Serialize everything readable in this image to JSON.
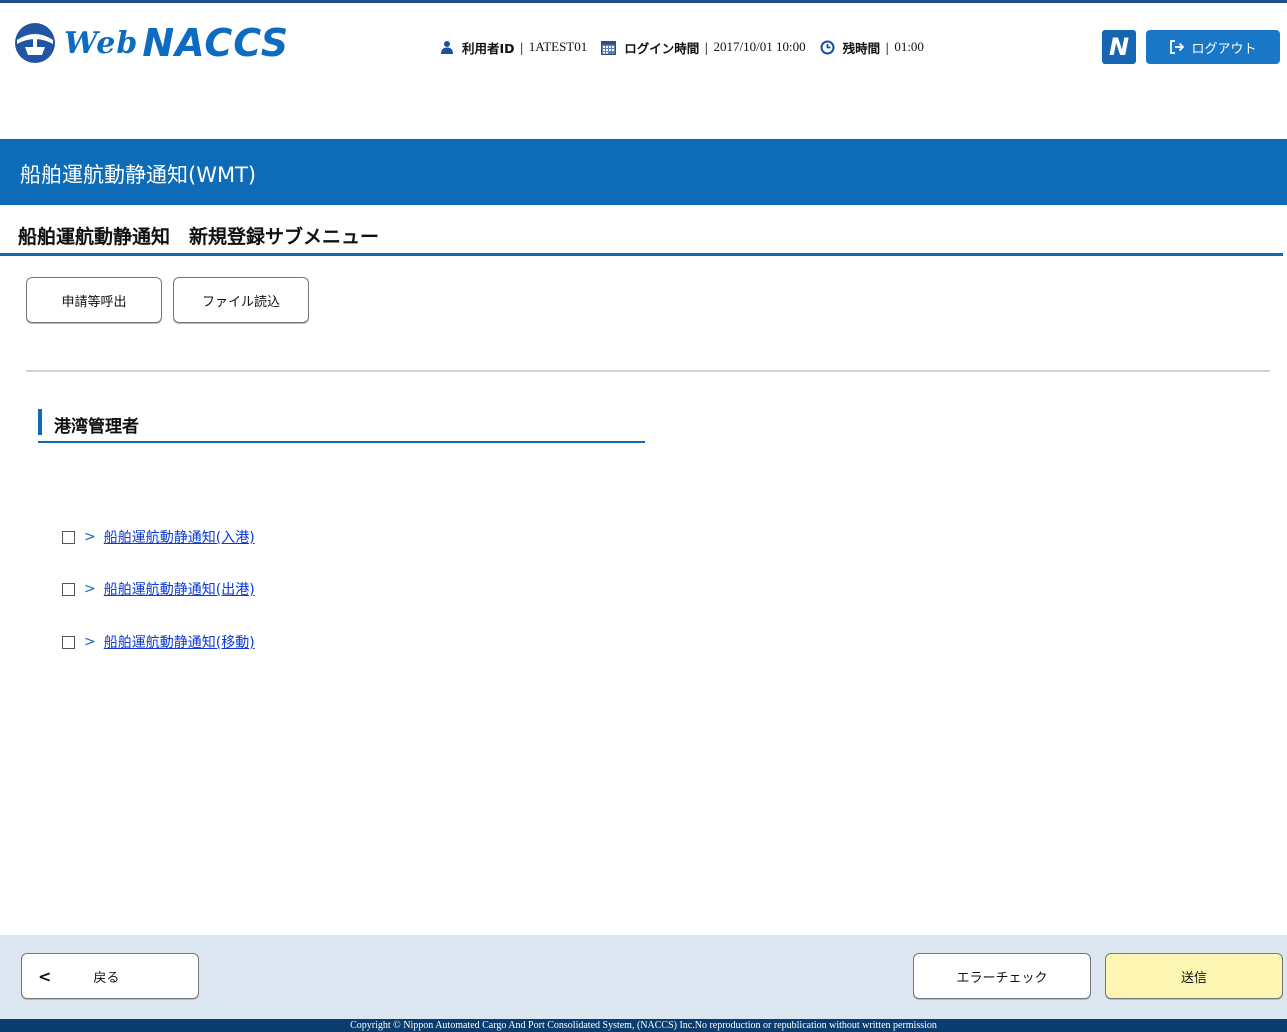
{
  "header": {
    "logo_web": "Web",
    "logo_naccs": "NACCS",
    "user_id_label": "利用者ID",
    "user_id": "1ATEST01",
    "login_time_label": "ログイン時間",
    "login_time": "2017/10/01 10:00",
    "remaining_label": "残時間",
    "remaining": "01:00",
    "n_icon": "N",
    "logout_label": "ログアウト",
    "separator": "|"
  },
  "page": {
    "title": "船舶運航動静通知(WMT)",
    "subtitle": "船舶運航動静通知　新規登録サブメニュー"
  },
  "toolbar": {
    "apply_label": "申請等呼出",
    "file_label": "ファイル読込"
  },
  "section": {
    "title": "港湾管理者",
    "items": [
      {
        "label": "船舶運航動静通知(入港)"
      },
      {
        "label": "船舶運航動静通知(出港)"
      },
      {
        "label": "船舶運航動静通知(移動)"
      }
    ]
  },
  "footer": {
    "back_label": "戻る",
    "error_check_label": "エラーチェック",
    "send_label": "送信",
    "copyright": "Copyright © Nippon Automated Cargo And Port Consolidated System, (NACCS) Inc.No reproduction or republication without written permission"
  },
  "colors": {
    "brand_blue": "#0d6bb8",
    "footer_bg": "#dde7f2",
    "send_bg": "#fdf5b2",
    "link": "#0b38d6"
  },
  "icons": {
    "logo": "ship-globe-logo-icon",
    "user": "user-icon",
    "calendar": "calendar-icon",
    "clock": "clock-icon",
    "logout": "logout-icon",
    "chevron": "chevron-right-icon",
    "back": "chevron-left-icon"
  }
}
